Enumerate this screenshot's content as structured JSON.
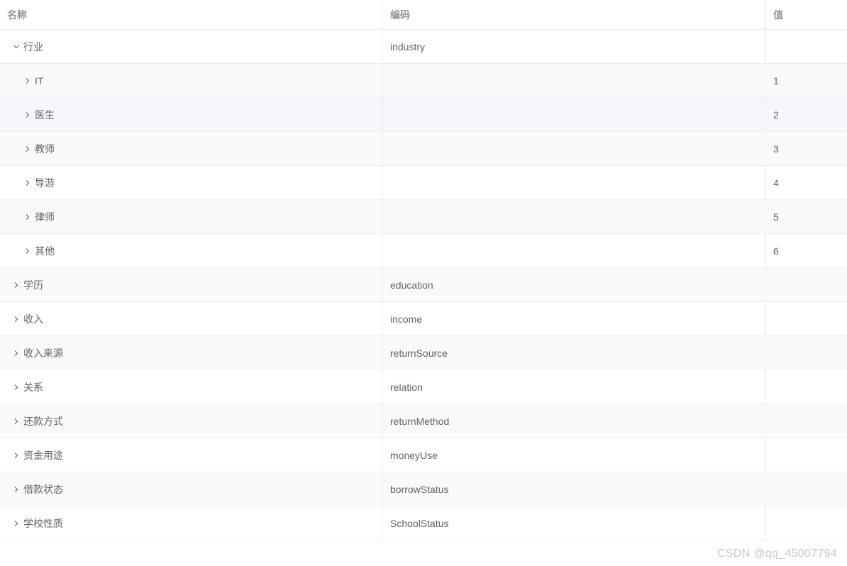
{
  "table": {
    "headers": {
      "name": "名称",
      "code": "编码",
      "value": "值"
    },
    "rows": [
      {
        "name": "行业",
        "code": "industry",
        "value": "",
        "level": 1,
        "expanded": true
      },
      {
        "name": "IT",
        "code": "",
        "value": "1",
        "level": 2,
        "expanded": false
      },
      {
        "name": "医生",
        "code": "",
        "value": "2",
        "level": 2,
        "expanded": false
      },
      {
        "name": "教师",
        "code": "",
        "value": "3",
        "level": 2,
        "expanded": false
      },
      {
        "name": "导游",
        "code": "",
        "value": "4",
        "level": 2,
        "expanded": false
      },
      {
        "name": "律师",
        "code": "",
        "value": "5",
        "level": 2,
        "expanded": false
      },
      {
        "name": "其他",
        "code": "",
        "value": "6",
        "level": 2,
        "expanded": false
      },
      {
        "name": "学历",
        "code": "education",
        "value": "",
        "level": 1,
        "expanded": false
      },
      {
        "name": "收入",
        "code": "income",
        "value": "",
        "level": 1,
        "expanded": false
      },
      {
        "name": "收入来源",
        "code": "returnSource",
        "value": "",
        "level": 1,
        "expanded": false
      },
      {
        "name": "关系",
        "code": "relation",
        "value": "",
        "level": 1,
        "expanded": false
      },
      {
        "name": "还款方式",
        "code": "returnMethod",
        "value": "",
        "level": 1,
        "expanded": false
      },
      {
        "name": "资金用途",
        "code": "moneyUse",
        "value": "",
        "level": 1,
        "expanded": false
      },
      {
        "name": "借款状态",
        "code": "borrowStatus",
        "value": "",
        "level": 1,
        "expanded": false
      },
      {
        "name": "学校性质",
        "code": "SchoolStatus",
        "value": "",
        "level": 1,
        "expanded": false
      }
    ]
  },
  "watermark": "CSDN @qq_45007794",
  "colors": {
    "header_text": "#909399",
    "body_text": "#606266",
    "border": "#ebeef5",
    "stripe": "#fafafa",
    "hover": "#f5f7fa"
  }
}
